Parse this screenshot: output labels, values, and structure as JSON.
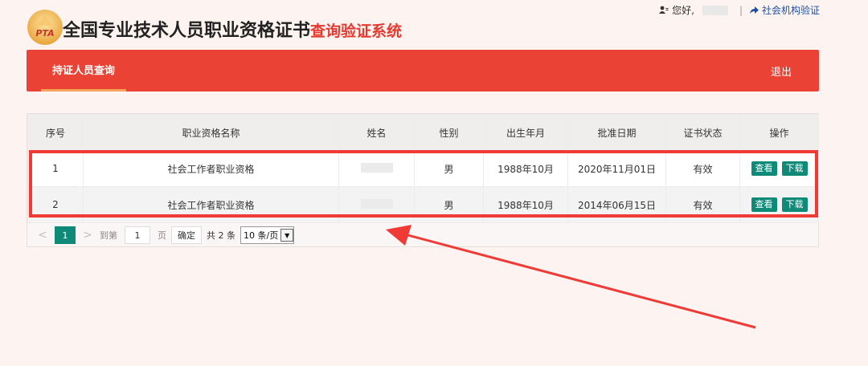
{
  "header": {
    "logo_text": "PTA",
    "title_main": "全国专业技术人员职业资格证书",
    "title_sub": "查询验证系统"
  },
  "topbar": {
    "greeting": "您好,",
    "separator": "|",
    "org_link": "社会机构验证"
  },
  "nav": {
    "tab_label": "持证人员查询",
    "logout_label": "退出"
  },
  "table": {
    "headers": [
      "序号",
      "职业资格名称",
      "姓名",
      "性别",
      "出生年月",
      "批准日期",
      "证书状态",
      "操作"
    ],
    "rows": [
      {
        "index": "1",
        "qualification": "社会工作者职业资格",
        "gender": "男",
        "birth": "1988年10月",
        "approved": "2020年11月01日",
        "status": "有效"
      },
      {
        "index": "2",
        "qualification": "社会工作者职业资格",
        "gender": "男",
        "birth": "1988年10月",
        "approved": "2014年06月15日",
        "status": "有效"
      }
    ],
    "actions": {
      "view_label": "查看",
      "download_label": "下载"
    }
  },
  "pager": {
    "prev": "<",
    "next": ">",
    "current_page": "1",
    "goto_label": "到第",
    "page_input_value": "1",
    "page_label": "页",
    "confirm_label": "确定",
    "total_label": "共 2 条",
    "page_size_label": "10 条/页"
  },
  "colors": {
    "brand_red": "#ea4335",
    "accent_green": "#0f8a79",
    "annotation_red": "#f03a36"
  }
}
